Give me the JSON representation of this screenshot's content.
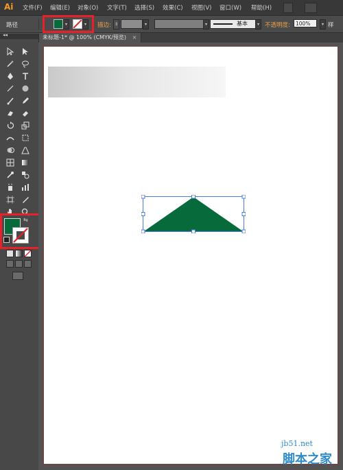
{
  "app": {
    "logo": "Ai"
  },
  "menu": [
    "文件(F)",
    "编辑(E)",
    "对象(O)",
    "文字(T)",
    "选择(S)",
    "效果(C)",
    "视图(V)",
    "窗口(W)",
    "帮助(H)"
  ],
  "control_bar": {
    "object_type": "路径",
    "fill_color": "#076a3b",
    "stroke_swatch": "none-swatch",
    "stroke_label": "描边:",
    "line_style_label": "基本",
    "opacity_label": "不透明度:",
    "opacity_value": "100%",
    "style_label": "样"
  },
  "document_tab": {
    "title": "未标题-1* @ 100% (CMYK/预览)",
    "close_glyph": "×"
  },
  "tools_panel": {
    "collapse_glyph": "◂◂",
    "fill_color": "#076a3b",
    "stroke_color": "#ffffff",
    "swap_glyph": "⇆"
  },
  "canvas": {
    "shape_fill": "#076a3b",
    "selection_color": "#4a7be0",
    "gradient_rect": "light-gray-gradient"
  },
  "watermark": {
    "url": "jb51.net",
    "name": "脚本之家"
  }
}
